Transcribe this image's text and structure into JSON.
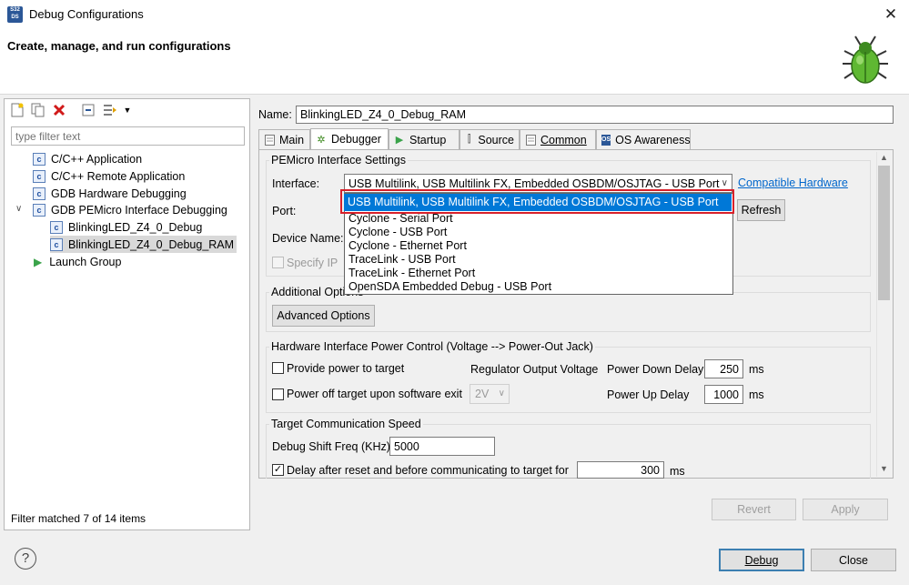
{
  "window": {
    "title": "Debug Configurations",
    "app_icon_label": "S32DS"
  },
  "header": {
    "title": "Create, manage, and run configurations"
  },
  "left": {
    "toolbar": {
      "new_icon": "new-configuration-icon",
      "duplicate_icon": "duplicate-icon",
      "delete_icon": "delete-icon",
      "collapse_icon": "collapse-all-icon",
      "filter_icon": "filter-icon",
      "menu_icon": "chevron-down-icon"
    },
    "filter_placeholder": "type filter text",
    "tree": [
      {
        "label": "C/C++ Application"
      },
      {
        "label": "C/C++ Remote Application"
      },
      {
        "label": "GDB Hardware Debugging"
      },
      {
        "label": "GDB PEMicro Interface Debugging"
      },
      {
        "label": "BlinkingLED_Z4_0_Debug"
      },
      {
        "label": "BlinkingLED_Z4_0_Debug_RAM"
      },
      {
        "label": "Launch Group"
      }
    ],
    "status": "Filter matched 7 of 14 items"
  },
  "right": {
    "name_label": "Name:",
    "name_value": "BlinkingLED_Z4_0_Debug_RAM",
    "tabs": [
      "Main",
      "Debugger",
      "Startup",
      "Source",
      "Common",
      "OS Awareness"
    ],
    "pemicro": {
      "title": "PEMicro Interface Settings",
      "interface_label": "Interface:",
      "interface_value": "USB Multilink, USB Multilink FX, Embedded OSBDM/OSJTAG - USB Port",
      "compatible_link": "Compatible Hardware",
      "port_label": "Port:",
      "refresh": "Refresh",
      "device_label": "Device Name:",
      "specify_ip": "Specify IP",
      "dropdown_options": [
        "USB Multilink, USB Multilink FX, Embedded OSBDM/OSJTAG - USB Port",
        "Cyclone - Serial Port",
        "Cyclone - USB Port",
        "Cyclone - Ethernet Port",
        "TraceLink - USB Port",
        "TraceLink - Ethernet Port",
        "OpenSDA Embedded Debug - USB Port"
      ]
    },
    "additional": {
      "title": "Additional Options",
      "button": "Advanced Options"
    },
    "power": {
      "title": "Hardware Interface Power Control (Voltage --> Power-Out Jack)",
      "provide_power": "Provide power to target",
      "power_off": "Power off target upon software exit",
      "regulator_label": "Regulator Output Voltage",
      "regulator_value": "2V",
      "power_down_label": "Power Down Delay",
      "power_down_value": "250",
      "power_up_label": "Power Up Delay",
      "power_up_value": "1000",
      "unit": "ms"
    },
    "speed": {
      "title": "Target Communication Speed",
      "shift_label": "Debug Shift Freq (KHz)",
      "shift_value": "5000",
      "delay_label": "Delay after reset and before communicating to target for",
      "delay_value": "300",
      "unit": "ms"
    },
    "revert": "Revert",
    "apply": "Apply"
  },
  "footer": {
    "debug": "Debug",
    "close": "Close"
  }
}
